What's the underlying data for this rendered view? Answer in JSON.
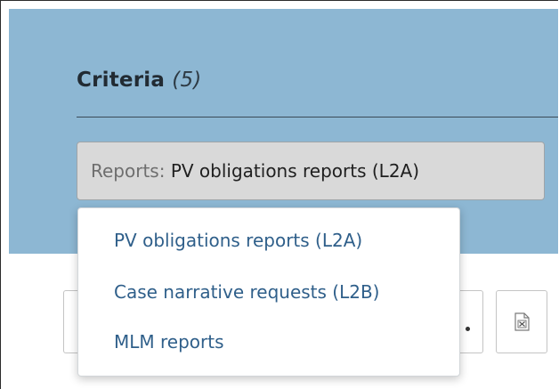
{
  "criteria": {
    "title": "Criteria",
    "count": "(5)"
  },
  "filter": {
    "label": "Reports:",
    "value": "PV obligations reports (L2A)"
  },
  "dropdown": {
    "options": [
      "PV obligations reports (L2A)",
      "Case narrative requests (L2B)",
      "MLM reports"
    ]
  },
  "toolbar": {
    "icons": [
      "more-icon",
      "excel-export-icon"
    ]
  },
  "colors": {
    "panel_bg": "#8db7d3",
    "link": "#2f5f8a",
    "chip_bg": "#d9d9d9"
  }
}
